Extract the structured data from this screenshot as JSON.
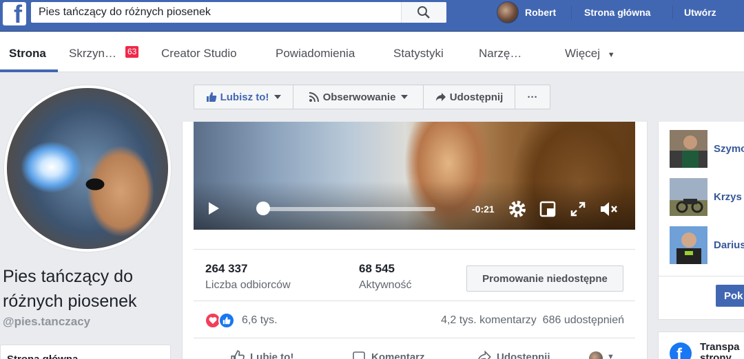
{
  "topbar": {
    "logo": "f",
    "search_value": "Pies tańczący do różnych piosenek",
    "user_name": "Robert",
    "home_label": "Strona główna",
    "create_label": "Utwórz"
  },
  "pagenav": {
    "tabs": [
      {
        "label": "Strona",
        "active": true
      },
      {
        "label": "Skrzyn…"
      },
      {
        "label": "Creator Studio"
      },
      {
        "label": "Powiadomienia"
      },
      {
        "label": "Statystyki"
      },
      {
        "label": "Narzę…"
      },
      {
        "label": "Więcej"
      }
    ],
    "inbox_badge": "63"
  },
  "page": {
    "name": "Pies tańczący do różnych piosenek",
    "handle": "@pies.tanczacy",
    "left_menu_first": "Strona główna"
  },
  "actions": {
    "like": "Lubisz to!",
    "follow": "Obserwowanie",
    "share": "Udostępnij",
    "more": "···"
  },
  "video": {
    "time_remaining": "-0:21",
    "progress_fraction": 0.02
  },
  "stats": {
    "reach_value": "264 337",
    "reach_label": "Liczba odbiorców",
    "engagement_value": "68 545",
    "engagement_label": "Aktywność",
    "promote_label": "Promowanie niedostępne"
  },
  "post": {
    "reactions_count": "6,6 tys.",
    "comments": "4,2 tys. komentarzy",
    "shares": "686 udostępnień",
    "like_action": "Lubię to!",
    "comment_action": "Komentarz",
    "share_action": "Udostępnij"
  },
  "sidebar": {
    "friends": [
      {
        "name": "Szymo"
      },
      {
        "name": "Krzys"
      },
      {
        "name": "Darius"
      }
    ],
    "poke_label": "Pok",
    "transparency_label_1": "Transpa",
    "transparency_label_2": "strony"
  }
}
